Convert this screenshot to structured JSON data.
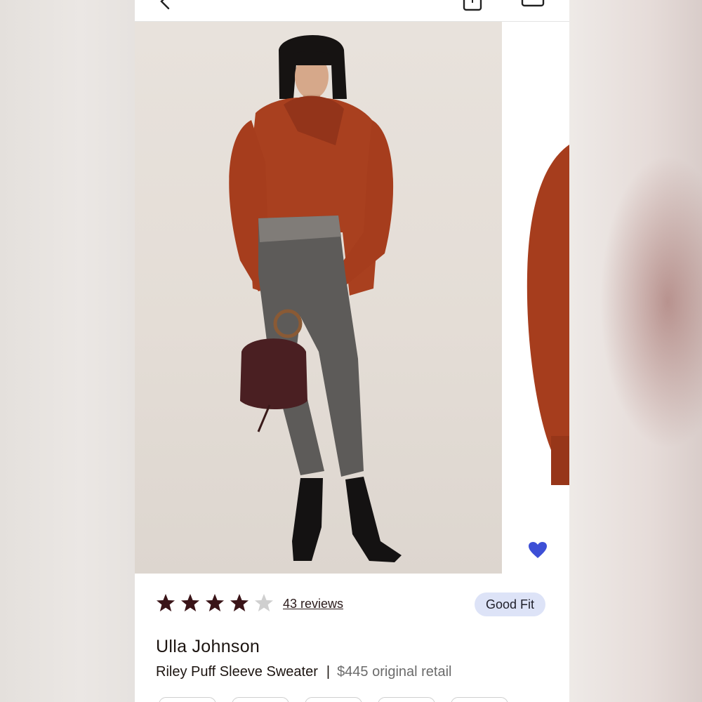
{
  "header": {
    "back_icon": "chevron-left-icon",
    "bag_icon": "shopping-bag-icon",
    "menu_icon": "menu-icon"
  },
  "gallery": {
    "favorite_icon": "heart-icon",
    "favorite_color": "#3d4fd6"
  },
  "rating": {
    "stars_filled": 4,
    "stars_total": 5,
    "reviews_label": "43 reviews"
  },
  "fit_badge": "Good Fit",
  "product": {
    "brand": "Ulla Johnson",
    "name": "Riley Puff Sleeve Sweater",
    "separator": "|",
    "retail": "$445 original retail"
  },
  "colors": {
    "star_filled": "#3a1418",
    "star_empty": "#cfcfcf",
    "badge_bg": "#dde3f7"
  }
}
